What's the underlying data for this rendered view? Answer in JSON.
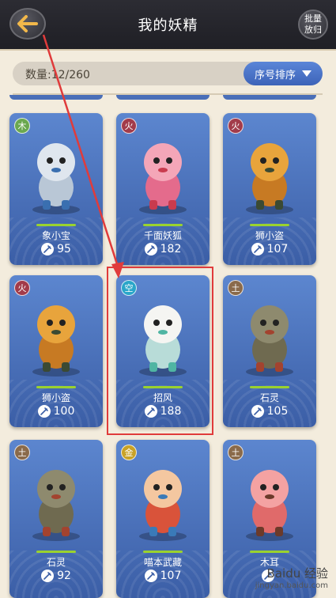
{
  "header": {
    "title": "我的妖精",
    "batch_label_line1": "批量",
    "batch_label_line2": "放归"
  },
  "toolbar": {
    "count_text": "数量:12/260",
    "sort_label": "序号排序"
  },
  "cards": [
    {
      "element": "木",
      "element_color": "#6aa84f",
      "name": "象小宝",
      "power": "95"
    },
    {
      "element": "火",
      "element_color": "#a23b4a",
      "name": "千面妖狐",
      "power": "182"
    },
    {
      "element": "火",
      "element_color": "#a23b4a",
      "name": "狮小盗",
      "power": "107"
    },
    {
      "element": "火",
      "element_color": "#a23b4a",
      "name": "狮小盗",
      "power": "100"
    },
    {
      "element": "空",
      "element_color": "#2aa6c9",
      "name": "招风",
      "power": "188"
    },
    {
      "element": "土",
      "element_color": "#8a6a4a",
      "name": "石灵",
      "power": "105"
    },
    {
      "element": "土",
      "element_color": "#8a6a4a",
      "name": "石灵",
      "power": "92"
    },
    {
      "element": "金",
      "element_color": "#c9a227",
      "name": "喵本武藏",
      "power": "107"
    },
    {
      "element": "土",
      "element_color": "#8a6a4a",
      "name": "木耳",
      "power": ""
    }
  ],
  "watermark": {
    "title": "Baidu 经验",
    "url": "jingyan.baidu.com"
  }
}
